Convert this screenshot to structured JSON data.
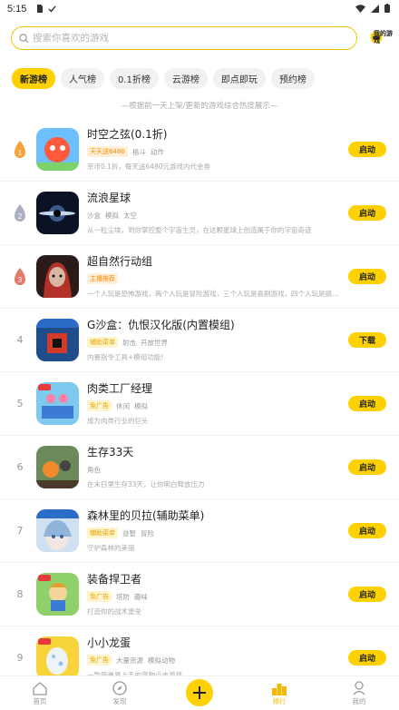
{
  "status": {
    "time": "5:15"
  },
  "search": {
    "placeholder": "搜索你喜欢的游戏",
    "my_games_label": "我的游戏"
  },
  "tabs": [
    {
      "label": "新游榜",
      "active": true
    },
    {
      "label": "人气榜",
      "active": false
    },
    {
      "label": "0.1折榜",
      "active": false
    },
    {
      "label": "云游榜",
      "active": false
    },
    {
      "label": "即点即玩",
      "active": false
    },
    {
      "label": "预约榜",
      "active": false
    }
  ],
  "notice": "—根据前一天上架/更新的游戏综合热度展示—",
  "games": [
    {
      "rank": "1",
      "title": "时空之弦(0.1折)",
      "badge": "天天送6480",
      "badge_style": "orange",
      "tags": [
        "格斗",
        "动作"
      ],
      "desc": "京币0.1折，每天送6480元游戏内代金券",
      "button": "启动"
    },
    {
      "rank": "2",
      "title": "流浪星球",
      "badge": "",
      "badge_style": "",
      "tags": [
        "沙盒",
        "模拟",
        "太空"
      ],
      "desc": "从一粒尘埃，到你掌控整个宇宙生灵，在这颗星球上创造属于你的宇宙奇迹",
      "button": "启动"
    },
    {
      "rank": "3",
      "title": "超自然行动组",
      "badge": "主播推荐",
      "badge_style": "orange",
      "tags": [],
      "desc": "一个人玩是恐怖游戏，两个人玩是冒险游戏，三个人玩是喜剧游戏，四个人玩是搞笑游戏",
      "button": "启动"
    },
    {
      "rank": "4",
      "title": "G沙盒：仇恨汉化版(内置模组)",
      "badge": "辅助菜单",
      "badge_style": "yellow",
      "tags": [
        "射击",
        "开放世界"
      ],
      "desc": "内置指令工具+模组功能!",
      "button": "下载"
    },
    {
      "rank": "5",
      "title": "肉类工厂经理",
      "badge": "免广告",
      "badge_style": "yellow",
      "tags": [
        "休闲",
        "模拟"
      ],
      "desc": "成为肉类行业的巨头",
      "button": "启动"
    },
    {
      "rank": "6",
      "title": "生存33天",
      "badge": "",
      "badge_style": "",
      "tags": [
        "角色"
      ],
      "desc": "在末日里生存33天，让你明白释放压力",
      "button": "启动"
    },
    {
      "rank": "7",
      "title": "森林里的贝拉(辅助菜单)",
      "badge": "辅助菜单",
      "badge_style": "yellow",
      "tags": [
        "益智",
        "冒险"
      ],
      "desc": "守护森林的美丽",
      "button": "启动"
    },
    {
      "rank": "8",
      "title": "装备捍卫者",
      "badge": "免广告",
      "badge_style": "yellow",
      "tags": [
        "塔防",
        "趣味"
      ],
      "desc": "打造你的战术堡垒",
      "button": "启动"
    },
    {
      "rank": "9",
      "title": "小小龙蛋",
      "badge": "免广告",
      "badge_style": "yellow",
      "tags": [
        "大量资源",
        "模拟动物"
      ],
      "desc": "一款简单易上手的宠物点击游戏",
      "button": "启动"
    }
  ],
  "bottom_nav": [
    {
      "label": "首页",
      "icon": "home-icon",
      "active": false
    },
    {
      "label": "发现",
      "icon": "compass-icon",
      "active": false
    },
    {
      "label": "",
      "icon": "plus-icon",
      "active": false
    },
    {
      "label": "排行",
      "icon": "ranking-icon",
      "active": true
    },
    {
      "label": "我的",
      "icon": "profile-icon",
      "active": false
    }
  ],
  "colors": {
    "accent": "#ffd100",
    "accent_text": "#f5b800",
    "rank_top": "#f4a23a"
  }
}
